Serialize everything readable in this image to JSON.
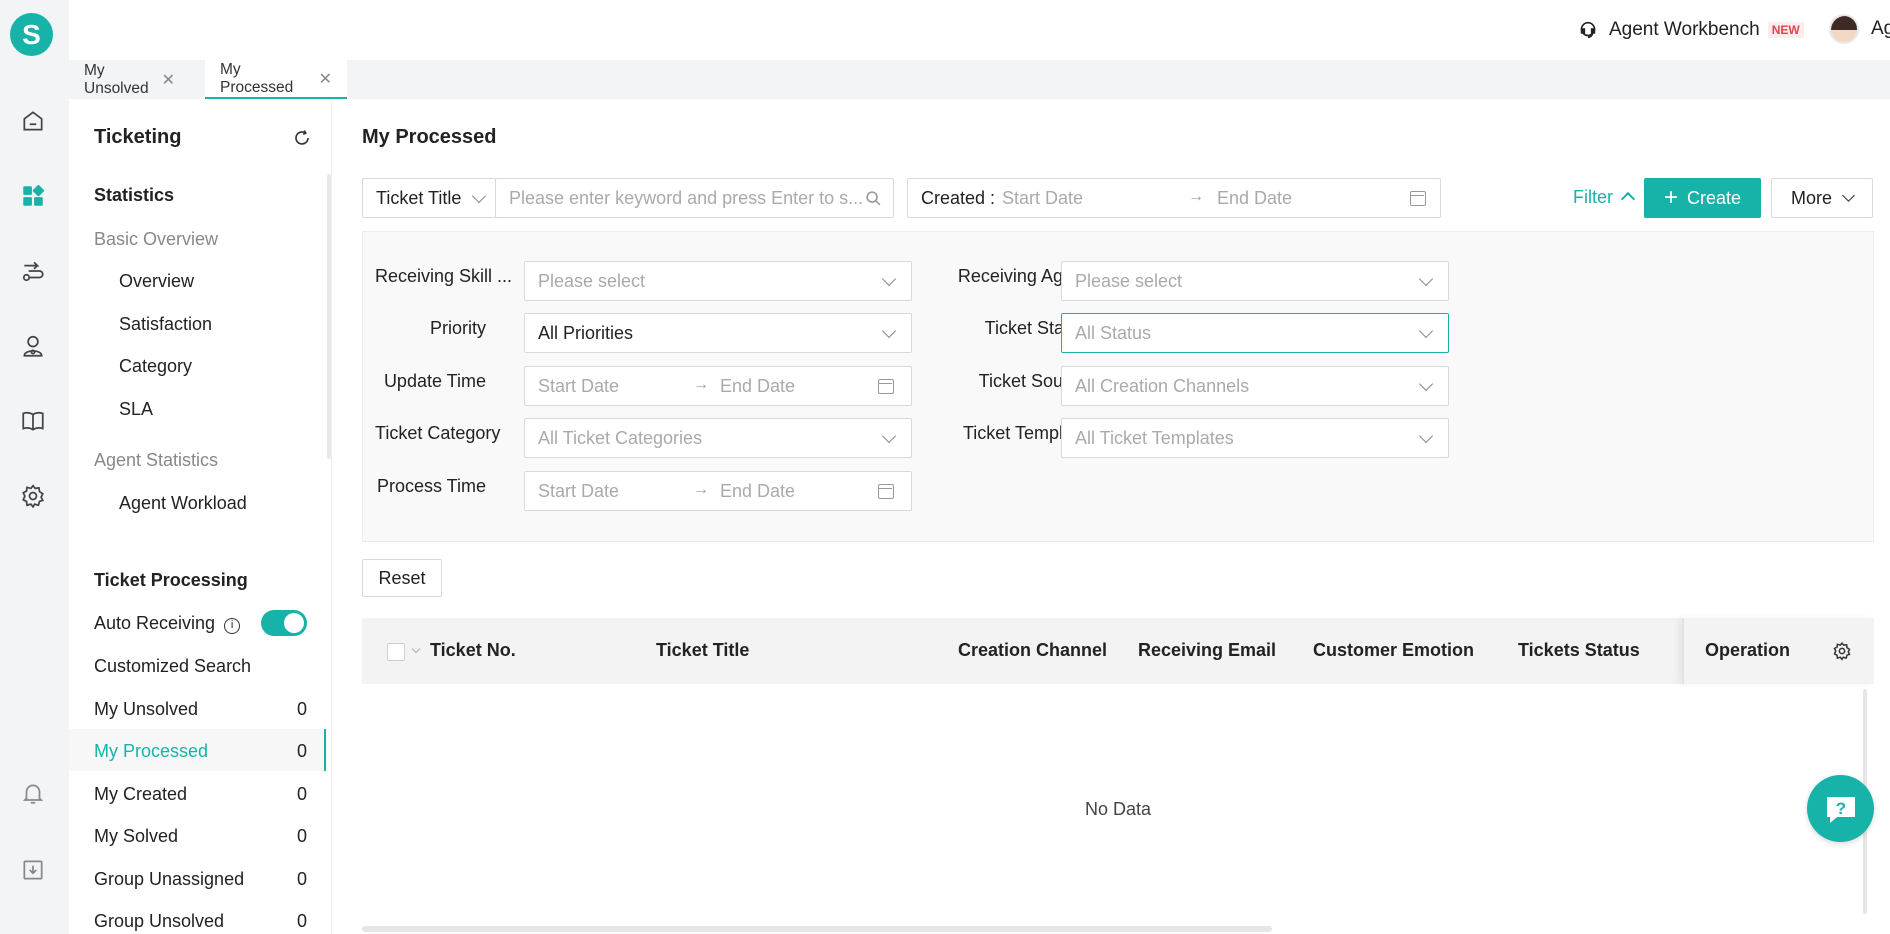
{
  "app": {
    "logo_letter": "S",
    "accent": "#17b3a9"
  },
  "header": {
    "workbench_label": "Agent Workbench",
    "new_badge": "NEW",
    "user_name": "Agent"
  },
  "tabs": [
    {
      "label": "My Unsolved"
    },
    {
      "label": "My Processed"
    }
  ],
  "sidebar": {
    "title": "Ticketing",
    "statistics_header": "Statistics",
    "basic_overview": "Basic Overview",
    "overview": "Overview",
    "satisfaction": "Satisfaction",
    "category": "Category",
    "sla": "SLA",
    "agent_statistics": "Agent Statistics",
    "agent_workload": "Agent Workload",
    "processing_header": "Ticket Processing",
    "auto_receiving": "Auto Receiving",
    "customized_search": "Customized Search",
    "lists": [
      {
        "label": "My Unsolved",
        "count": "0"
      },
      {
        "label": "My Processed",
        "count": "0"
      },
      {
        "label": "My Created",
        "count": "0"
      },
      {
        "label": "My Solved",
        "count": "0"
      },
      {
        "label": "Group Unassigned",
        "count": "0"
      },
      {
        "label": "Group Unsolved",
        "count": "0"
      }
    ]
  },
  "main": {
    "title": "My Processed",
    "search_field": "Ticket Title",
    "search_placeholder": "Please enter keyword and press Enter to s...",
    "created_label": "Created :",
    "start_date": "Start Date",
    "end_date": "End Date",
    "filter_label": "Filter",
    "create_label": "Create",
    "more_label": "More",
    "reset_label": "Reset",
    "no_data": "No Data"
  },
  "filters": {
    "receiving_skill": {
      "label": "Receiving Skill ...",
      "value": "Please select"
    },
    "receiving_agent": {
      "label": "Receiving Agent",
      "value": "Please select"
    },
    "priority": {
      "label": "Priority",
      "value": "All Priorities"
    },
    "ticket_status": {
      "label": "Ticket Status",
      "value": "All Status"
    },
    "update_time": {
      "label": "Update Time",
      "start": "Start Date",
      "end": "End Date"
    },
    "ticket_source": {
      "label": "Ticket Source",
      "value": "All Creation Channels"
    },
    "ticket_category": {
      "label": "Ticket Category",
      "value": "All Ticket Categories"
    },
    "ticket_template": {
      "label": "Ticket Template",
      "value": "All Ticket Templates"
    },
    "process_time": {
      "label": "Process Time",
      "start": "Start Date",
      "end": "End Date"
    }
  },
  "table": {
    "columns": [
      "Ticket No.",
      "Ticket Title",
      "Creation Channel",
      "Receiving Email",
      "Customer Emotion",
      "Tickets Status",
      "Operation"
    ]
  }
}
